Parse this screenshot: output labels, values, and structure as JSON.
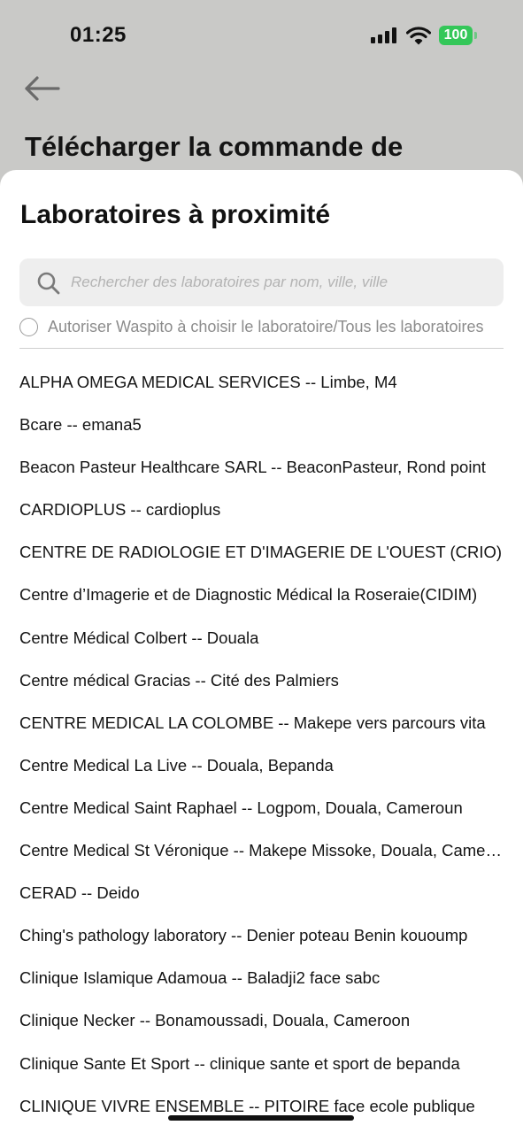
{
  "status_bar": {
    "time": "01:25",
    "battery": "100",
    "battery_color": "#34c759",
    "icons": [
      "signal-icon",
      "wifi-icon",
      "battery-icon"
    ]
  },
  "background_page": {
    "back_icon": "arrow-left-icon",
    "title": "Télécharger la commande de"
  },
  "sheet": {
    "title": "Laboratoires à proximité",
    "search": {
      "icon": "search-icon",
      "placeholder": "Rechercher des laboratoires par nom, ville, ville",
      "value": ""
    },
    "allow_option": {
      "label": "Autoriser Waspito à choisir le laboratoire/Tous les laboratoires",
      "checked": false
    },
    "labs": [
      "ALPHA OMEGA MEDICAL SERVICES -- Limbe, M4",
      "Bcare -- emana5",
      "Beacon Pasteur Healthcare SARL -- BeaconPasteur, Rond point",
      "CARDIOPLUS -- cardioplus",
      "CENTRE DE RADIOLOGIE ET D'IMAGERIE DE L'OUEST (CRIO)",
      "Centre d’Imagerie et de Diagnostic Médical la Roseraie(CIDIM)",
      "Centre Médical Colbert -- Douala",
      "Centre médical Gracias -- Cité des Palmiers",
      "CENTRE MEDICAL LA COLOMBE -- Makepe vers parcours vita",
      "Centre Medical La Live -- Douala, Bepanda",
      "Centre Medical Saint Raphael -- Logpom, Douala, Cameroun",
      "Centre Medical St Véronique -- Makepe Missoke, Douala, Cameroun",
      "CERAD -- Deido",
      "Ching's pathology laboratory -- Denier poteau Benin kouoump",
      "Clinique Islamique Adamoua -- Baladji2 face sabc",
      "Clinique Necker -- Bonamoussadi, Douala, Cameroon",
      "Clinique Sante Et Sport -- clinique sante et sport de bepanda",
      "CLINIQUE VIVRE ENSEMBLE -- PITOIRE face ecole publique"
    ]
  }
}
